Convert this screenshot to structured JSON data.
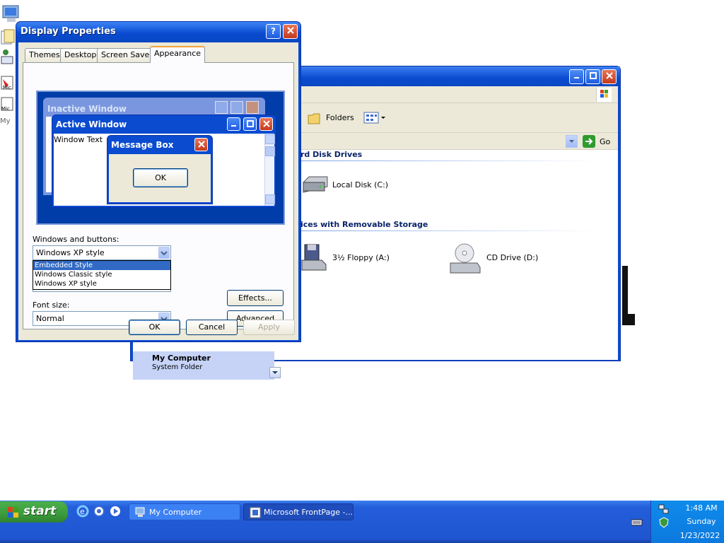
{
  "desktop": {
    "icons": [
      "My Computer",
      "My Documents",
      "Internet Explorer",
      "Microsoft FrontPage",
      "My Network Places"
    ]
  },
  "explorer": {
    "toolbar": {
      "folders_label": "Folders"
    },
    "address": {
      "go_label": "Go"
    },
    "sections": [
      {
        "title": "rd Disk Drives",
        "items": [
          {
            "label": "Local Disk (C:)",
            "icon": "hard-disk-icon"
          }
        ]
      },
      {
        "title": "ices with Removable Storage",
        "items": [
          {
            "label": "3½ Floppy (A:)",
            "icon": "floppy-icon"
          },
          {
            "label": "CD Drive (D:)",
            "icon": "cd-drive-icon"
          }
        ]
      }
    ],
    "details": {
      "title": "My Computer",
      "subtitle": "System Folder"
    }
  },
  "dialog": {
    "title": "Display Properties",
    "tabs": [
      "Themes",
      "Desktop",
      "Screen Saver",
      "Appearance"
    ],
    "active_tab": "Appearance",
    "preview": {
      "inactive_title": "Inactive Window",
      "active_title": "Active Window",
      "window_text": "Window Text",
      "message_title": "Message Box",
      "message_ok": "OK"
    },
    "windows_buttons_label": "Windows and buttons:",
    "windows_buttons_value": "Windows XP style",
    "dropdown_options": [
      "Embedded Style",
      "Windows Classic style",
      "Windows XP style"
    ],
    "dropdown_selected": "Embedded Style",
    "font_size_label": "Font size:",
    "font_size_value": "Normal",
    "effects_label": "Effects...",
    "advanced_label": "Advanced",
    "ok_label": "OK",
    "cancel_label": "Cancel",
    "apply_label": "Apply"
  },
  "taskbar": {
    "start_label": "start",
    "tasks": [
      "My Computer",
      "Microsoft FrontPage -..."
    ],
    "clock": {
      "time": "1:48 AM",
      "day": "Sunday",
      "date": "1/23/2022"
    }
  },
  "colors": {
    "xp_blue": "#0a4bd0",
    "start_green": "#3c9b3c",
    "dialog_bg": "#ece9d8"
  }
}
